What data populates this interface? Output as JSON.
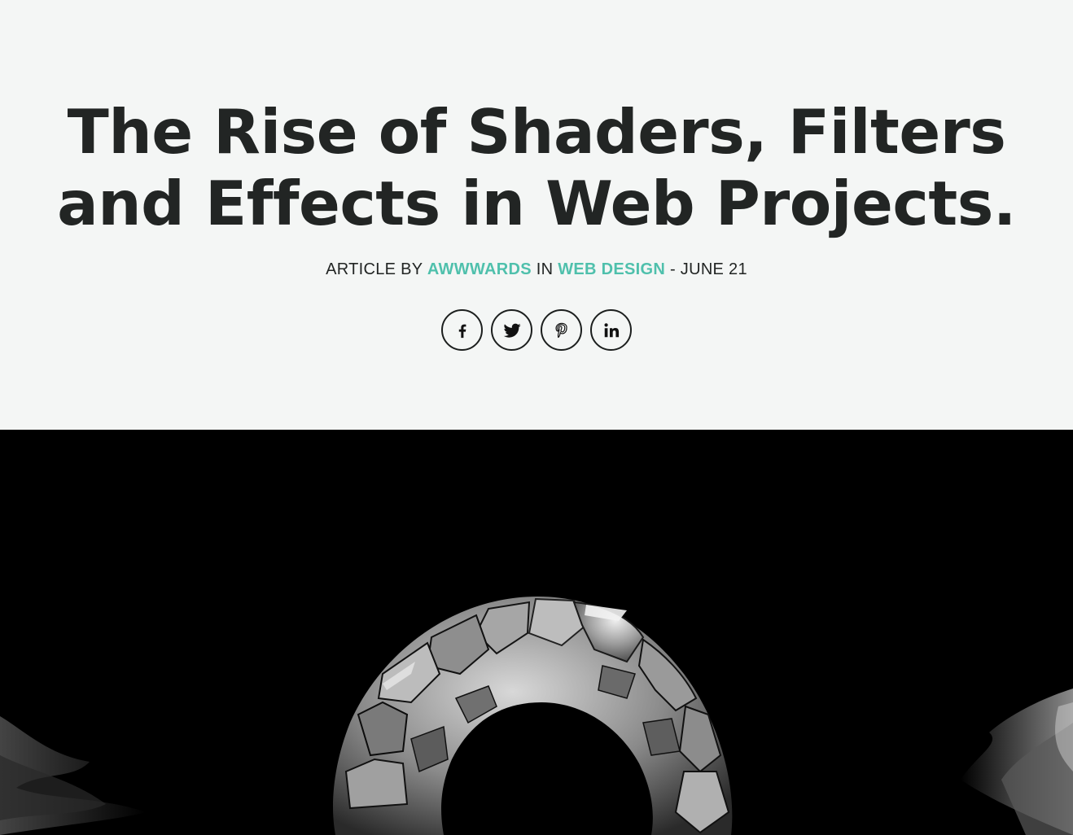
{
  "article": {
    "title_line1": "The Rise of Shaders, Filters",
    "title_line2": "and Effects in Web Projects.",
    "byline": {
      "prefix": "ARTICLE BY",
      "author": "AWWWARDS",
      "in_word": "IN",
      "category": "WEB DESIGN",
      "date": "- JUNE 21"
    }
  },
  "share": {
    "buttons": [
      {
        "icon": "facebook-icon"
      },
      {
        "icon": "twitter-icon"
      },
      {
        "icon": "pinterest-icon"
      },
      {
        "icon": "linkedin-icon"
      }
    ]
  },
  "colors": {
    "background": "#f4f6f5",
    "text": "#222524",
    "accent": "#4fc0ac",
    "hero_background": "#000000"
  }
}
